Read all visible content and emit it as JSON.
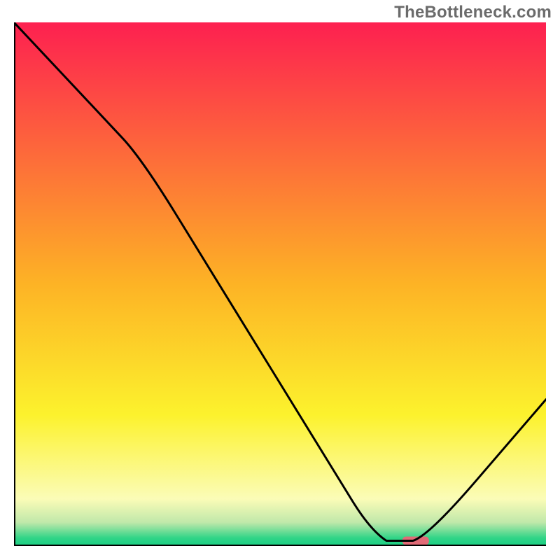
{
  "watermark": "TheBottleneck.com",
  "chart_data": {
    "type": "line",
    "title": "",
    "xlabel": "",
    "ylabel": "",
    "xlim": [
      0,
      100
    ],
    "ylim": [
      0,
      100
    ],
    "grid": false,
    "series": [
      {
        "name": "curve",
        "x": [
          0,
          24,
          67,
          73,
          75,
          78,
          100
        ],
        "y": [
          100,
          74,
          3,
          1,
          1,
          2,
          28
        ]
      }
    ],
    "marker": {
      "x_start": 73,
      "x_end": 78,
      "y": 1,
      "color": "#e16b77"
    },
    "background_gradient": {
      "stops": [
        {
          "offset": 0.0,
          "color": "#fd2050"
        },
        {
          "offset": 0.5,
          "color": "#fdb325"
        },
        {
          "offset": 0.75,
          "color": "#fcf22d"
        },
        {
          "offset": 0.91,
          "color": "#fbfcb7"
        },
        {
          "offset": 0.955,
          "color": "#c0e8aa"
        },
        {
          "offset": 0.985,
          "color": "#2fd487"
        },
        {
          "offset": 1.0,
          "color": "#1bce83"
        }
      ]
    },
    "axis_color": "#000000",
    "line_color": "#000000",
    "line_width": 3
  }
}
